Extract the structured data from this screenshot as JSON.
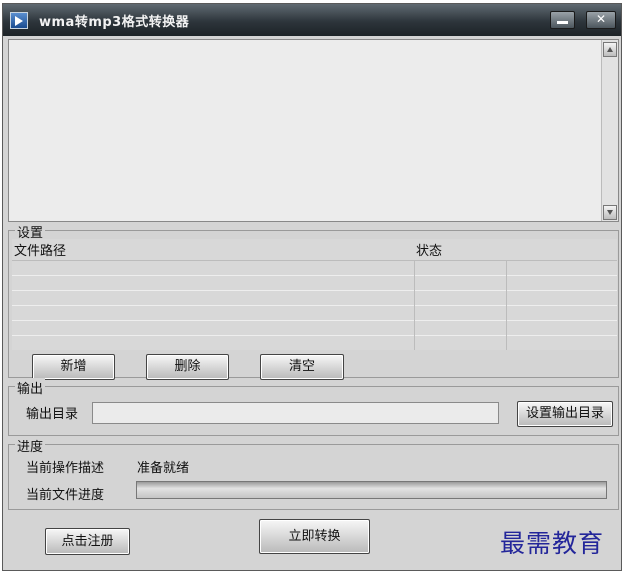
{
  "window": {
    "title": "wma转mp3格式转换器",
    "minimize_label": "",
    "close_label": "✕"
  },
  "settings": {
    "legend": "设置",
    "columns": [
      "文件路径",
      "状态",
      ""
    ],
    "rows": [
      [
        "",
        "",
        ""
      ],
      [
        "",
        "",
        ""
      ],
      [
        "",
        "",
        ""
      ],
      [
        "",
        "",
        ""
      ],
      [
        "",
        "",
        ""
      ],
      [
        "",
        "",
        ""
      ]
    ],
    "add_label": "新增",
    "delete_label": "删除",
    "clear_label": "清空"
  },
  "output": {
    "legend": "输出",
    "dir_label": "输出目录",
    "dir_value": "",
    "set_dir_label": "设置输出目录"
  },
  "progress": {
    "legend": "进度",
    "op_label": "当前操作描述",
    "op_value": "准备就绪",
    "file_label": "当前文件进度",
    "file_progress": 0
  },
  "footer": {
    "register_label": "点击注册",
    "convert_label": "立即转换"
  },
  "watermark": "最需教育"
}
